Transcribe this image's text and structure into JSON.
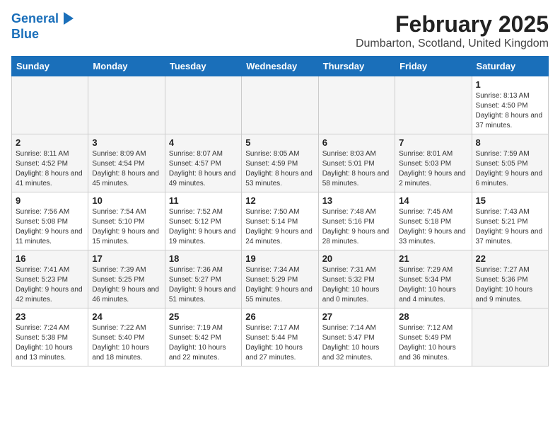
{
  "logo": {
    "line1": "General",
    "line2": "Blue"
  },
  "header": {
    "title": "February 2025",
    "subtitle": "Dumbarton, Scotland, United Kingdom"
  },
  "days_of_week": [
    "Sunday",
    "Monday",
    "Tuesday",
    "Wednesday",
    "Thursday",
    "Friday",
    "Saturday"
  ],
  "weeks": [
    [
      {
        "day": "",
        "info": ""
      },
      {
        "day": "",
        "info": ""
      },
      {
        "day": "",
        "info": ""
      },
      {
        "day": "",
        "info": ""
      },
      {
        "day": "",
        "info": ""
      },
      {
        "day": "",
        "info": ""
      },
      {
        "day": "1",
        "info": "Sunrise: 8:13 AM\nSunset: 4:50 PM\nDaylight: 8 hours and 37 minutes."
      }
    ],
    [
      {
        "day": "2",
        "info": "Sunrise: 8:11 AM\nSunset: 4:52 PM\nDaylight: 8 hours and 41 minutes."
      },
      {
        "day": "3",
        "info": "Sunrise: 8:09 AM\nSunset: 4:54 PM\nDaylight: 8 hours and 45 minutes."
      },
      {
        "day": "4",
        "info": "Sunrise: 8:07 AM\nSunset: 4:57 PM\nDaylight: 8 hours and 49 minutes."
      },
      {
        "day": "5",
        "info": "Sunrise: 8:05 AM\nSunset: 4:59 PM\nDaylight: 8 hours and 53 minutes."
      },
      {
        "day": "6",
        "info": "Sunrise: 8:03 AM\nSunset: 5:01 PM\nDaylight: 8 hours and 58 minutes."
      },
      {
        "day": "7",
        "info": "Sunrise: 8:01 AM\nSunset: 5:03 PM\nDaylight: 9 hours and 2 minutes."
      },
      {
        "day": "8",
        "info": "Sunrise: 7:59 AM\nSunset: 5:05 PM\nDaylight: 9 hours and 6 minutes."
      }
    ],
    [
      {
        "day": "9",
        "info": "Sunrise: 7:56 AM\nSunset: 5:08 PM\nDaylight: 9 hours and 11 minutes."
      },
      {
        "day": "10",
        "info": "Sunrise: 7:54 AM\nSunset: 5:10 PM\nDaylight: 9 hours and 15 minutes."
      },
      {
        "day": "11",
        "info": "Sunrise: 7:52 AM\nSunset: 5:12 PM\nDaylight: 9 hours and 19 minutes."
      },
      {
        "day": "12",
        "info": "Sunrise: 7:50 AM\nSunset: 5:14 PM\nDaylight: 9 hours and 24 minutes."
      },
      {
        "day": "13",
        "info": "Sunrise: 7:48 AM\nSunset: 5:16 PM\nDaylight: 9 hours and 28 minutes."
      },
      {
        "day": "14",
        "info": "Sunrise: 7:45 AM\nSunset: 5:18 PM\nDaylight: 9 hours and 33 minutes."
      },
      {
        "day": "15",
        "info": "Sunrise: 7:43 AM\nSunset: 5:21 PM\nDaylight: 9 hours and 37 minutes."
      }
    ],
    [
      {
        "day": "16",
        "info": "Sunrise: 7:41 AM\nSunset: 5:23 PM\nDaylight: 9 hours and 42 minutes."
      },
      {
        "day": "17",
        "info": "Sunrise: 7:39 AM\nSunset: 5:25 PM\nDaylight: 9 hours and 46 minutes."
      },
      {
        "day": "18",
        "info": "Sunrise: 7:36 AM\nSunset: 5:27 PM\nDaylight: 9 hours and 51 minutes."
      },
      {
        "day": "19",
        "info": "Sunrise: 7:34 AM\nSunset: 5:29 PM\nDaylight: 9 hours and 55 minutes."
      },
      {
        "day": "20",
        "info": "Sunrise: 7:31 AM\nSunset: 5:32 PM\nDaylight: 10 hours and 0 minutes."
      },
      {
        "day": "21",
        "info": "Sunrise: 7:29 AM\nSunset: 5:34 PM\nDaylight: 10 hours and 4 minutes."
      },
      {
        "day": "22",
        "info": "Sunrise: 7:27 AM\nSunset: 5:36 PM\nDaylight: 10 hours and 9 minutes."
      }
    ],
    [
      {
        "day": "23",
        "info": "Sunrise: 7:24 AM\nSunset: 5:38 PM\nDaylight: 10 hours and 13 minutes."
      },
      {
        "day": "24",
        "info": "Sunrise: 7:22 AM\nSunset: 5:40 PM\nDaylight: 10 hours and 18 minutes."
      },
      {
        "day": "25",
        "info": "Sunrise: 7:19 AM\nSunset: 5:42 PM\nDaylight: 10 hours and 22 minutes."
      },
      {
        "day": "26",
        "info": "Sunrise: 7:17 AM\nSunset: 5:44 PM\nDaylight: 10 hours and 27 minutes."
      },
      {
        "day": "27",
        "info": "Sunrise: 7:14 AM\nSunset: 5:47 PM\nDaylight: 10 hours and 32 minutes."
      },
      {
        "day": "28",
        "info": "Sunrise: 7:12 AM\nSunset: 5:49 PM\nDaylight: 10 hours and 36 minutes."
      },
      {
        "day": "",
        "info": ""
      }
    ]
  ]
}
